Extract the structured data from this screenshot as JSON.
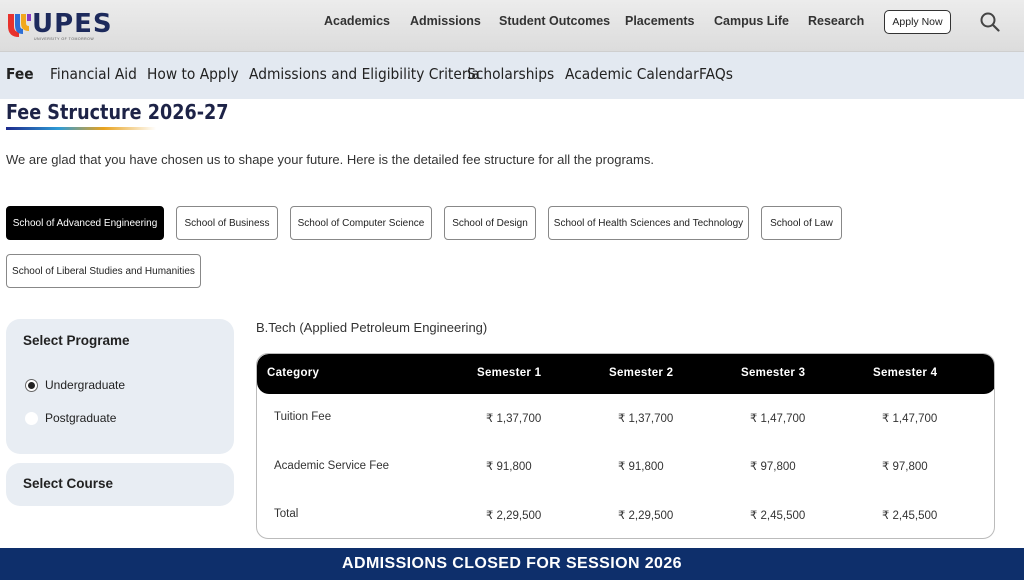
{
  "brand": {
    "name": "UPES",
    "tagline": "UNIVERSITY OF TOMORROW"
  },
  "top_nav": {
    "items": [
      "Academics",
      "Admissions",
      "Student Outcomes",
      "Placements",
      "Campus Life",
      "Research"
    ],
    "apply_label": "Apply Now",
    "search_icon": "search-icon"
  },
  "sub_nav": {
    "items": [
      "Fee",
      "Financial Aid",
      "How to Apply",
      "Admissions and Eligibility Criteria",
      "Scholarships",
      "Academic Calendar",
      "FAQs"
    ],
    "active": "Fee"
  },
  "page": {
    "title": "Fee Structure 2026-27",
    "intro": "We are glad that you have chosen us to shape your future. Here is the detailed fee structure for all the programs."
  },
  "schools": {
    "items": [
      "School of Advanced Engineering",
      "School of Business",
      "School of Computer Science",
      "School of Design",
      "School of Health Sciences and Technology",
      "School of Law",
      "School of Liberal Studies and Humanities"
    ],
    "active": "School of Advanced Engineering"
  },
  "program_panel": {
    "title": "Select Programe",
    "options": [
      "Undergraduate",
      "Postgraduate"
    ],
    "selected": "Undergraduate"
  },
  "course_panel": {
    "title": "Select Course"
  },
  "program_name": "B.Tech (Applied Petroleum Engineering)",
  "fee_table": {
    "headers": [
      "Category",
      "Semester 1",
      "Semester 2",
      "Semester 3",
      "Semester 4"
    ],
    "rows": [
      [
        "Tuition Fee",
        "₹  1,37,700",
        "₹  1,37,700",
        "₹  1,47,700",
        "₹  1,47,700"
      ],
      [
        "Academic Service Fee",
        "₹  91,800",
        "₹  91,800",
        "₹  97,800",
        "₹  97,800"
      ],
      [
        "Total",
        "₹  2,29,500",
        "₹  2,29,500",
        "₹  2,45,500",
        "₹  2,45,500"
      ]
    ]
  },
  "banner": {
    "text": "ADMISSIONS CLOSED FOR SESSION 2026"
  },
  "colors": {
    "banner": "#0e2f6b",
    "subnav_bg": "#e3e9f1",
    "active_chip": "#000000",
    "title": "#1d2347"
  }
}
